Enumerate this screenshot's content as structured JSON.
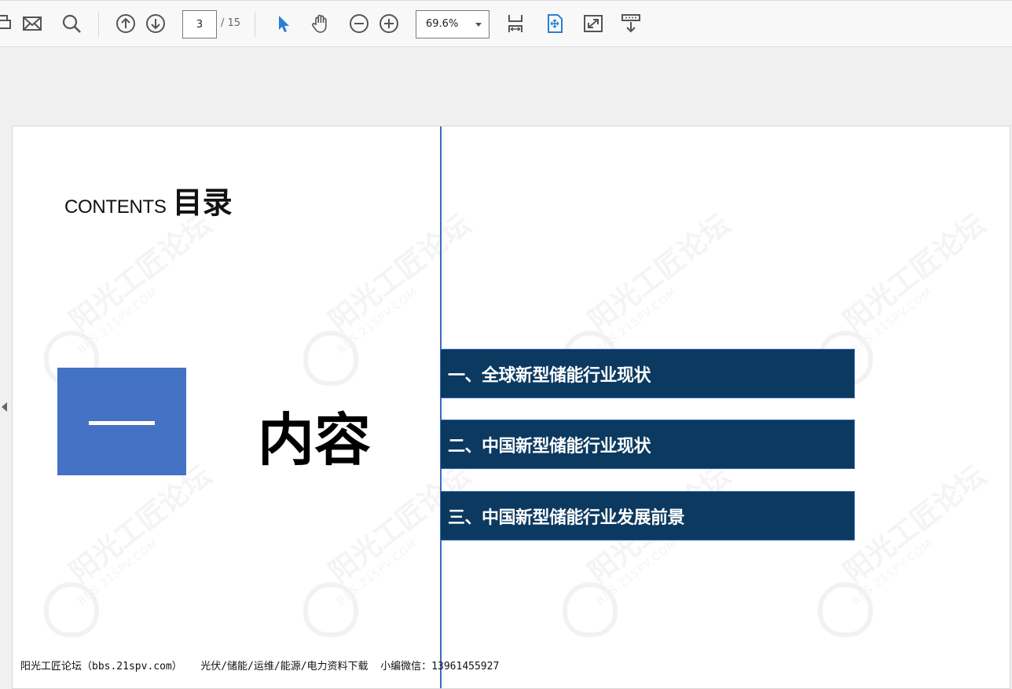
{
  "toolbar": {
    "current_page": "3",
    "total_pages": "/ 15",
    "zoom": "69.6%",
    "icons": [
      "print-icon",
      "mail-icon",
      "search-icon",
      "page-up-icon",
      "page-down-icon",
      "select-pointer-icon",
      "hand-tool-icon",
      "zoom-out-icon",
      "zoom-in-icon",
      "fit-page-icon",
      "rotate-fit-icon",
      "fullscreen-icon",
      "scroll-mode-icon"
    ],
    "accent": "#2a7fd4"
  },
  "slide": {
    "contents_en": "CONTENTS",
    "contents_cn": "目录",
    "section_number": "一",
    "section_title": "内容",
    "menu": [
      {
        "label": "一、全球新型储能行业现状"
      },
      {
        "label": "二、中国新型储能行业现状"
      },
      {
        "label": "三、中国新型储能行业发展前景"
      }
    ],
    "footer": "阳光工匠论坛（bbs.21spv.com）   光伏/储能/运维/能源/电力资料下载  小编微信：13961455927",
    "watermark_text": "阳光工匠论坛",
    "watermark_sub": "BBS.21SPV.COM",
    "colors": {
      "box": "#4472c4",
      "menu_bg": "#0b3960",
      "line": "#3a6cc0"
    }
  }
}
